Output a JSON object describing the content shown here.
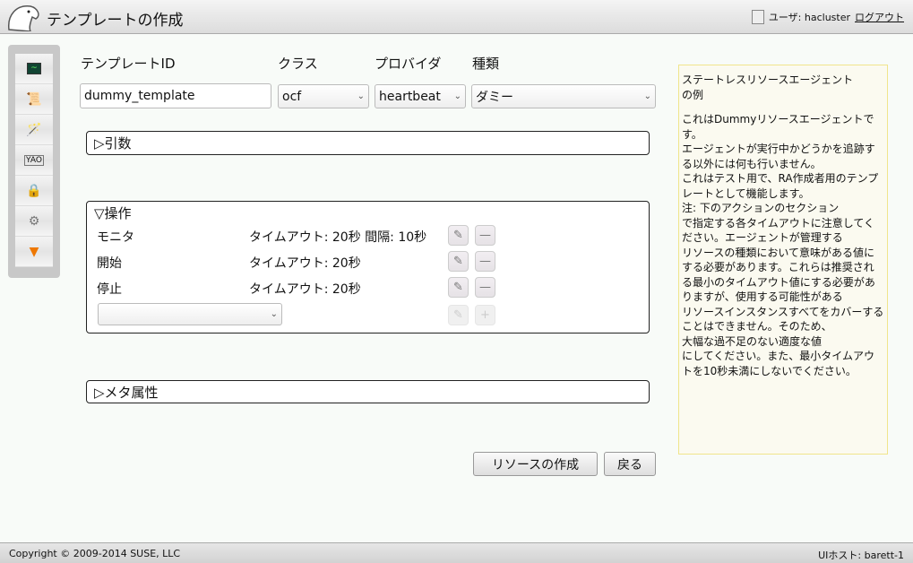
{
  "header": {
    "title": "テンプレートの作成",
    "user_label": "ユーザ: hacluster",
    "logout": "ログアウト"
  },
  "sidebar": {
    "items": [
      {
        "icon": "monitor-icon"
      },
      {
        "icon": "scroll-search-icon"
      },
      {
        "icon": "wand-icon"
      },
      {
        "icon": "config-icon"
      },
      {
        "icon": "lock-icon"
      },
      {
        "icon": "gears-icon"
      },
      {
        "icon": "filter-icon"
      }
    ]
  },
  "form": {
    "id_label": "テンプレートID",
    "id_value": "dummy_template",
    "class_label": "クラス",
    "class_value": "ocf",
    "provider_label": "プロバイダ",
    "provider_value": "heartbeat",
    "type_label": "種類",
    "type_value": "ダミー"
  },
  "args": {
    "title": "▷引数"
  },
  "ops": {
    "title": "▽操作",
    "rows": [
      {
        "name": "モニタ",
        "detail": "タイムアウト: 20秒 間隔: 10秒"
      },
      {
        "name": "開始",
        "detail": "タイムアウト: 20秒"
      },
      {
        "name": "停止",
        "detail": "タイムアウト: 20秒"
      }
    ],
    "new_select": ""
  },
  "meta": {
    "title": "▷メタ属性"
  },
  "buttons": {
    "create": "リソースの作成",
    "back": "戻る"
  },
  "help": {
    "title": "ステートレスリソースエージェント\nの例",
    "body": "これはDummyリソースエージェントです。\nエージェントが実行中かどうかを追跡する以外には何も行いません。\nこれはテスト用で、RA作成者用のテンプレートとして機能します。\n注: 下のアクションのセクション\nで指定する各タイムアウトに注意してください。エージェントが管理する\nリソースの種類において意味がある値にする必要があります。これらは推奨される最小のタイムアウト値にする必要がありますが、使用する可能性がある\nリソースインスタンスすべてをカバーすることはできません。そのため、\n大幅な過不足のない適度な値\nにしてください。また、最小タイムアウトを10秒未満にしないでください。"
  },
  "footer": {
    "copyright": "Copyright © 2009-2014 SUSE, LLC",
    "host": "UIホスト: barett-1"
  }
}
